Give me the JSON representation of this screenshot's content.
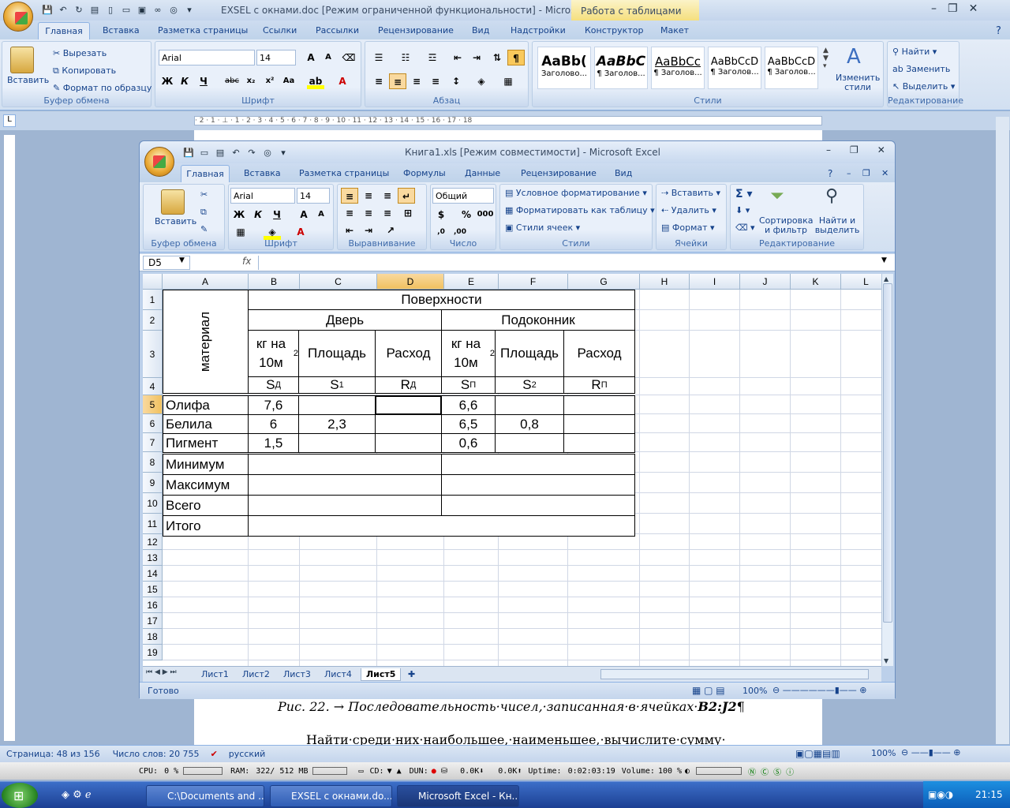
{
  "word": {
    "title": "EXSEL с окнами.doc [Режим ограниченной функциональности] - Microsoft ...",
    "context_tab": "Работа с таблицами",
    "tabs": [
      "Главная",
      "Вставка",
      "Разметка страницы",
      "Ссылки",
      "Рассылки",
      "Рецензирование",
      "Вид",
      "Надстройки",
      "Конструктор",
      "Макет"
    ],
    "clipboard": {
      "paste": "Вставить",
      "cut": "Вырезать",
      "copy": "Копировать",
      "format_painter": "Формат по образцу",
      "label": "Буфер обмена"
    },
    "font": {
      "name": "Arial",
      "size": "14",
      "label": "Шрифт"
    },
    "paragraph_label": "Абзац",
    "styles": {
      "items": [
        {
          "preview": "AaBb(",
          "name": "Заголово..."
        },
        {
          "preview": "AaBbC",
          "name": "¶ Заголов..."
        },
        {
          "preview": "AaBbCc",
          "name": "¶ Заголов..."
        },
        {
          "preview": "AaBbCcD",
          "name": "¶ Заголов..."
        },
        {
          "preview": "AaBbCcD",
          "name": "¶ Заголов..."
        }
      ],
      "change": "Изменить стили",
      "label": "Стили"
    },
    "editing": {
      "find": "Найти",
      "replace": "Заменить",
      "select": "Выделить",
      "label": "Редактирование"
    },
    "ruler_marks": "· 2 · 1 · ⊥ · 1 · 2 · 3 · 4 · 5 · 6 · 7 · 8 · 9 · 10 · 11 · 12 · 13 · 14 · 15 · 16 · 17 · 18",
    "caption": "Рис. 22. → Последовательность·чисел,·записанная·в·ячейках·",
    "caption_ref": "B2:J2",
    "caption_end": "¶",
    "body_line": "Найти·среди·них·наибольшее,·наименьшее,·вычислите·сумму·",
    "status": {
      "page": "Страница: 48 из 156",
      "words": "Число слов: 20 755",
      "lang": "русский",
      "zoom": "100%"
    }
  },
  "excel": {
    "title": "Книга1.xls [Режим совместимости] - Microsoft Excel",
    "tabs": [
      "Главная",
      "Вставка",
      "Разметка страницы",
      "Формулы",
      "Данные",
      "Рецензирование",
      "Вид"
    ],
    "clipboard": {
      "paste": "Вставить",
      "label": "Буфер обмена"
    },
    "font": {
      "name": "Arial",
      "size": "14",
      "label": "Шрифт"
    },
    "align_label": "Выравнивание",
    "number": {
      "format": "Общий",
      "label": "Число"
    },
    "styles": {
      "cond": "Условное форматирование",
      "as_table": "Форматировать как таблицу",
      "cell_styles": "Стили ячеек",
      "label": "Стили"
    },
    "cells": {
      "insert": "Вставить",
      "delete": "Удалить",
      "format": "Формат",
      "label": "Ячейки"
    },
    "editing": {
      "sort": "Сортировка и фильтр",
      "find": "Найти и выделить",
      "label": "Редактирование"
    },
    "name_box": "D5",
    "fx": "fx",
    "columns": [
      "A",
      "B",
      "C",
      "D",
      "E",
      "F",
      "G",
      "H",
      "I",
      "J",
      "K",
      "L"
    ],
    "rows": [
      "1",
      "2",
      "3",
      "4",
      "5",
      "6",
      "7",
      "8",
      "9",
      "10",
      "11",
      "12",
      "13",
      "14",
      "15",
      "16",
      "17",
      "18",
      "19"
    ],
    "table": {
      "surfaces": "Поверхности",
      "door": "Дверь",
      "sill": "Подоконник",
      "material": "материал",
      "kg_a": "кг на 10м",
      "kg_sup": "2",
      "area": "Площадь",
      "flow": "Расход",
      "s_d": "S",
      "s_d_sub": "Д",
      "s1": "S",
      "s1_sub": "1",
      "r_d": "R",
      "r_d_sub": "Д",
      "s_p": "S",
      "s_p_sub": "П",
      "s2": "S",
      "s2_sub": "2",
      "r_p": "R",
      "r_p_sub": "П",
      "materials": [
        "Олифа",
        "Белила",
        "Пигмент"
      ],
      "b": [
        "7,6",
        "6",
        "1,5"
      ],
      "c": [
        "",
        "2,3",
        ""
      ],
      "e": [
        "6,6",
        "6,5",
        "0,6"
      ],
      "f": [
        "",
        "0,8",
        ""
      ],
      "summary": [
        "Минимум",
        "Максимум",
        "Всего",
        "Итого"
      ]
    },
    "sheets": [
      "Лист1",
      "Лист2",
      "Лист3",
      "Лист4",
      "Лист5"
    ],
    "active_sheet": "Лист5",
    "status": {
      "ready": "Готово",
      "zoom": "100%"
    }
  },
  "sysbar": {
    "cpu": "CPU:",
    "cpu_val": "0 %",
    "ram": "RAM:",
    "ram_val": "322/ 512 MB",
    "cd": "CD:",
    "dun": "DUN:",
    "down": "0.0K",
    "up": "0.0K",
    "uptime_label": "Uptime:",
    "uptime": "0:02:03:19",
    "volume": "Volume:",
    "volume_val": "100 %"
  },
  "taskbar": {
    "items": [
      "C:\\Documents and ...",
      "EXSEL с окнами.do...",
      "Microsoft Excel - Кн..."
    ],
    "clock": "21:15"
  }
}
